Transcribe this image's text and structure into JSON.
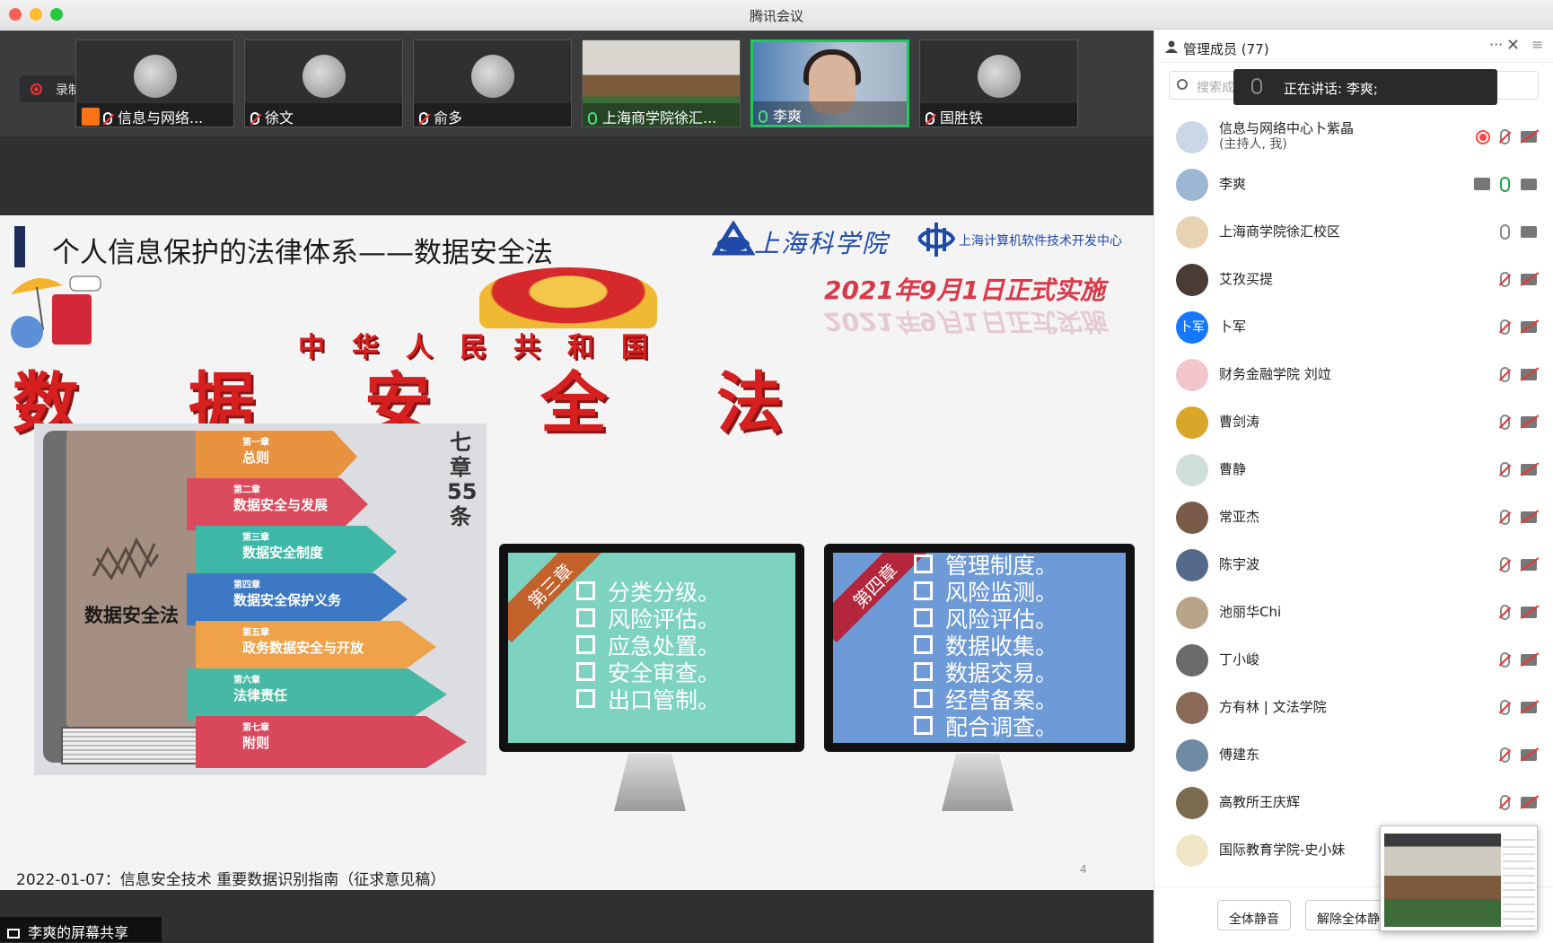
{
  "window": {
    "title": "腾讯会议"
  },
  "recording": {
    "label": "录制中"
  },
  "thumbnails": [
    {
      "name": "信息与网络...",
      "mic": "muted",
      "host": true,
      "type": "avatar"
    },
    {
      "name": "徐文",
      "mic": "muted",
      "type": "avatar"
    },
    {
      "name": "俞多",
      "mic": "muted",
      "type": "avatar"
    },
    {
      "name": "上海商学院徐汇...",
      "mic": "on",
      "type": "video-room"
    },
    {
      "name": "李爽",
      "mic": "on",
      "type": "video-person",
      "active": true
    },
    {
      "name": "国胜铁",
      "mic": "muted",
      "type": "avatar"
    }
  ],
  "slide": {
    "title": "个人信息保护的法律体系——数据安全法",
    "org_name": "上海科学院",
    "org_sub": "上海计算机软件技术开发中心",
    "effective_date": "2021年9月1日正式实施",
    "country": "中华人民共和国",
    "law_name": "数据安全法",
    "book_title": "数据安全法",
    "chapter_count": "七章55条",
    "chapters": [
      {
        "no": "第一章",
        "name": "总则",
        "color": "#e8913f"
      },
      {
        "no": "第二章",
        "name": "数据安全与发展",
        "color": "#d94b5c"
      },
      {
        "no": "第三章",
        "name": "数据安全制度",
        "color": "#3fb7a6"
      },
      {
        "no": "第四章",
        "name": "数据安全保护义务",
        "color": "#3c78c3"
      },
      {
        "no": "第五章",
        "name": "政务数据安全与开放",
        "color": "#f0a24a"
      },
      {
        "no": "第六章",
        "name": "法律责任",
        "color": "#47b8a3"
      },
      {
        "no": "第七章",
        "name": "附则",
        "color": "#d9485a"
      }
    ],
    "monitor_left": {
      "band": "第三章",
      "items": [
        "分类分级。",
        "风险评估。",
        "应急处置。",
        "安全审查。",
        "出口管制。"
      ],
      "bg": "#7dd3c0"
    },
    "monitor_right": {
      "band": "第四章",
      "items": [
        "管理制度。",
        "风险监测。",
        "风险评估。",
        "数据收集。",
        "数据交易。",
        "经营备案。",
        "配合调查。"
      ],
      "bg": "#6e9ad8"
    },
    "footer": "2022-01-07：信息安全技术 重要数据识别指南（征求意见稿）",
    "page_number": "4"
  },
  "share_label": "李爽的屏幕共享",
  "panel": {
    "title": "管理成员 (77)",
    "search_placeholder": "搜索成员",
    "speaking": "正在讲话: 李爽;",
    "members": [
      {
        "name": "信息与网络中心卜紫晶",
        "sub": "(主持人, 我)",
        "mic": "muted",
        "cam": "off",
        "rec": true,
        "avatar": "#c9d7e6"
      },
      {
        "name": "李爽",
        "mic": "on",
        "cam": "on",
        "share": true,
        "avatar": "#9bb7d4"
      },
      {
        "name": "上海商学院徐汇校区",
        "mic": "plain",
        "cam": "on",
        "avatar": "#e8d2b4"
      },
      {
        "name": "艾孜买提",
        "mic": "muted",
        "cam": "off",
        "avatar": "#4a3b34"
      },
      {
        "name": "卜军",
        "mic": "muted",
        "cam": "off",
        "avatar": "#1677ff",
        "initials": "卜军"
      },
      {
        "name": "财务金融学院 刘竝",
        "mic": "muted",
        "cam": "off",
        "avatar": "#f2c6cc"
      },
      {
        "name": "曹剑涛",
        "mic": "muted",
        "cam": "off",
        "avatar": "#d8a62a"
      },
      {
        "name": "曹静",
        "mic": "muted",
        "cam": "off",
        "avatar": "#cfe0d8"
      },
      {
        "name": "常亚杰",
        "mic": "muted",
        "cam": "off",
        "avatar": "#7a5a48"
      },
      {
        "name": "陈宇波",
        "mic": "muted",
        "cam": "off",
        "avatar": "#556a8a"
      },
      {
        "name": "池丽华Chi",
        "mic": "muted",
        "cam": "off",
        "avatar": "#b9a489"
      },
      {
        "name": "丁小峻",
        "mic": "muted",
        "cam": "off",
        "avatar": "#6b6b6b"
      },
      {
        "name": "方有林 | 文法学院",
        "mic": "muted",
        "cam": "off",
        "avatar": "#8a6a56"
      },
      {
        "name": "傅建东",
        "mic": "muted",
        "cam": "off",
        "avatar": "#6f8aa3"
      },
      {
        "name": "高教所王庆辉",
        "mic": "muted",
        "cam": "off",
        "avatar": "#7c6b4e"
      },
      {
        "name": "国际教育学院-史小妹",
        "mic": "none",
        "cam": "none",
        "avatar": "#efe6c8"
      }
    ],
    "mute_all": "全体静音",
    "unmute_all": "解除全体静音"
  }
}
